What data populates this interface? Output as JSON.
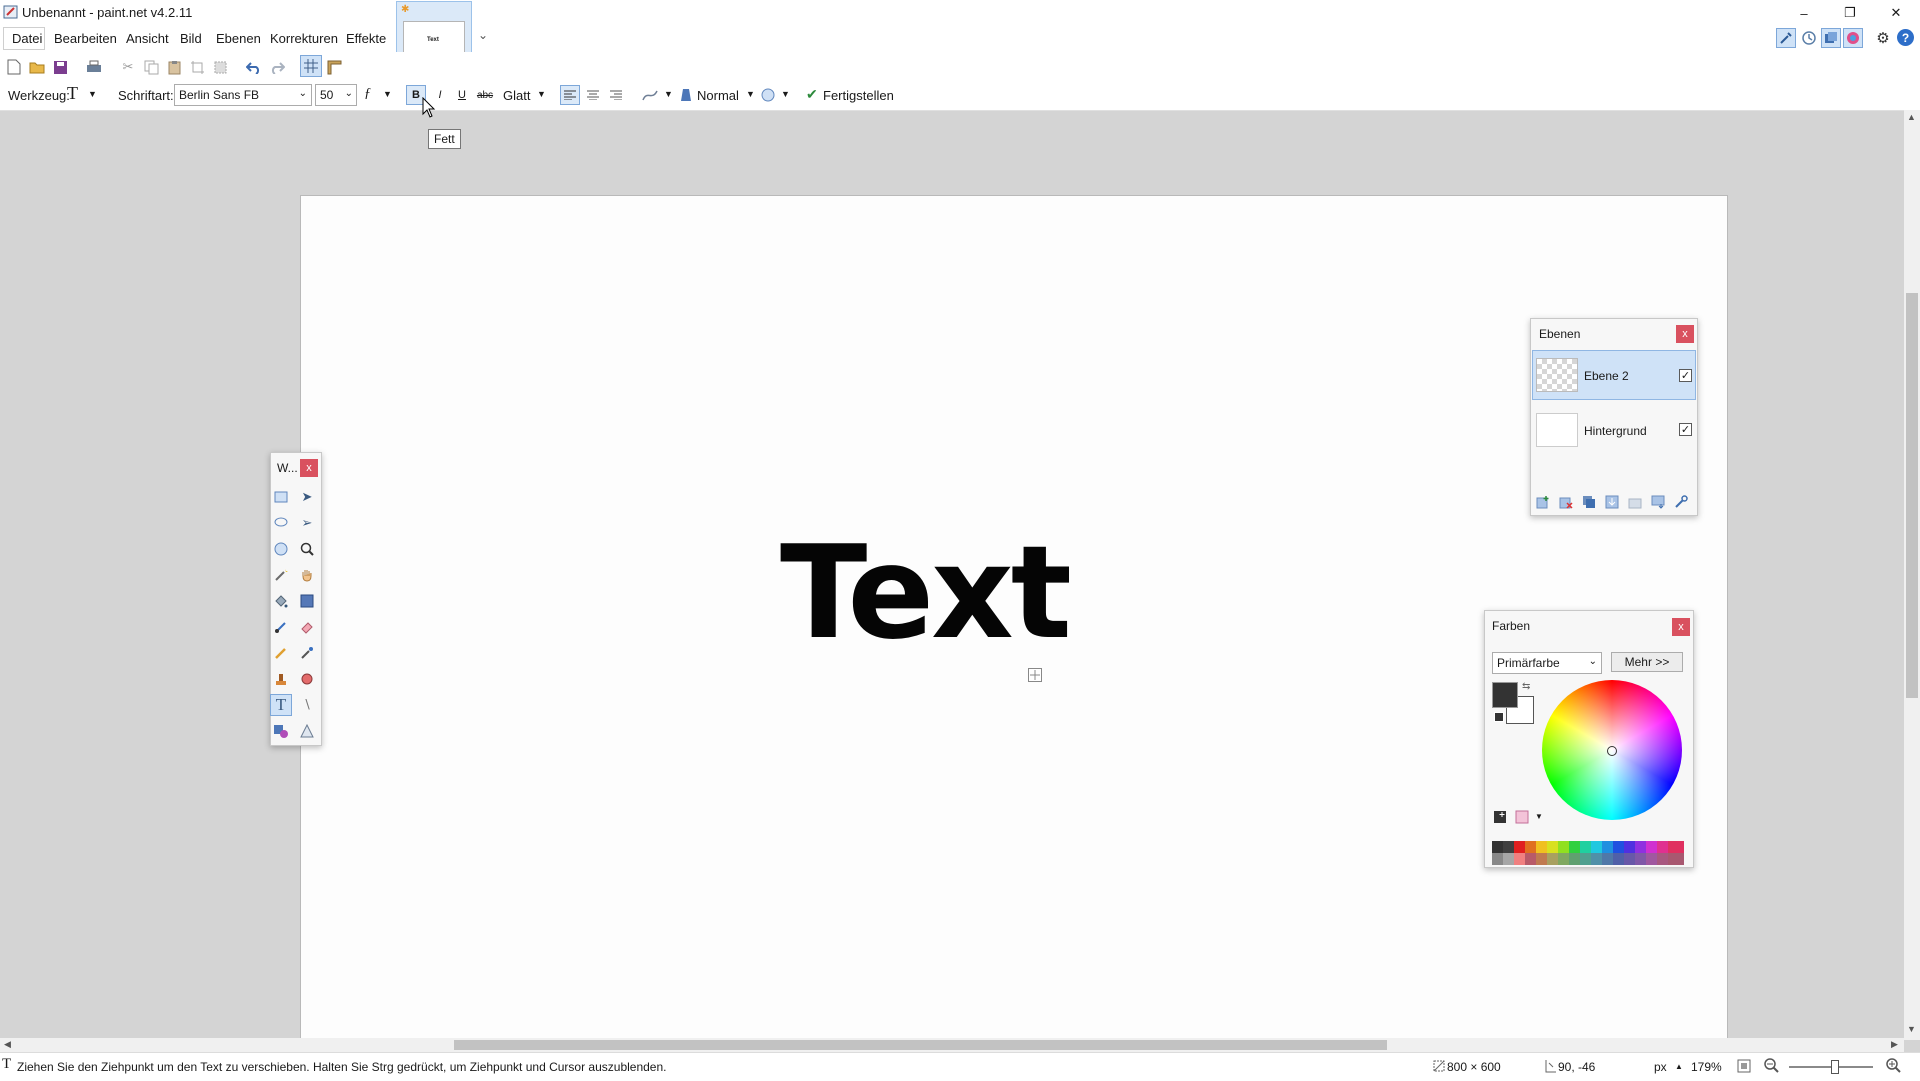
{
  "window": {
    "title": "Unbenannt - paint.net v4.2.11",
    "minimize": "–",
    "restore": "❐",
    "close": "✕"
  },
  "menu": [
    "Datei",
    "Bearbeiten",
    "Ansicht",
    "Bild",
    "Ebenen",
    "Korrekturen",
    "Effekte"
  ],
  "image_tab": {
    "thumb_text": "Text",
    "dirty_mark": "✱",
    "overflow": "⌄"
  },
  "options": {
    "tool_label": "Werkzeug:",
    "tool_icon": "T",
    "font_label": "Schriftart:",
    "font_value": "Berlin Sans FB",
    "size_value": "50",
    "bold": "B",
    "italic": "I",
    "underline": "U",
    "strike": "abc",
    "antialias": "Glatt",
    "blend": "Normal",
    "finish": "Fertigstellen"
  },
  "tooltip": "Fett",
  "canvas": {
    "text": "Text"
  },
  "tools_window": {
    "title": "W...",
    "close": "x"
  },
  "layers_window": {
    "title": "Ebenen",
    "close": "x",
    "layers": [
      {
        "name": "Ebene 2",
        "visible": true,
        "selected": true
      },
      {
        "name": "Hintergrund",
        "visible": true,
        "selected": false
      }
    ]
  },
  "colors_window": {
    "title": "Farben",
    "close": "x",
    "mode": "Primärfarbe",
    "more": "Mehr >>",
    "primary": "#333333",
    "secondary": "#ffffff"
  },
  "status": {
    "hint": "Ziehen Sie den Ziehpunkt um den Text zu verschieben. Halten Sie Strg gedrückt, um Ziehpunkt und Cursor auszublenden.",
    "size": "800 × 600",
    "cursor": "90, -46",
    "unit": "px",
    "zoom": "179%"
  },
  "colors": {
    "accent": "#dbe9f8",
    "close_red": "#d9515f",
    "selection": "#cfe2f7"
  }
}
